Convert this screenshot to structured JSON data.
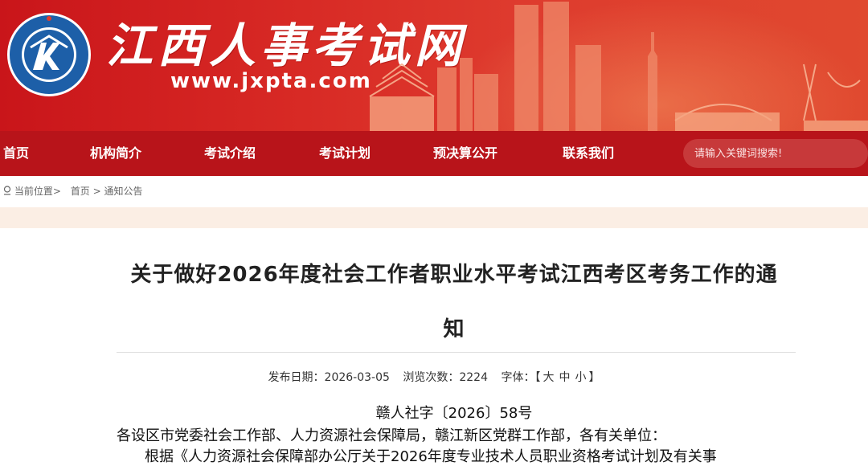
{
  "header": {
    "site_title": "江西人事考试网",
    "site_url": "www.jxpta.com",
    "logo_icon": "jxpta-emblem-icon",
    "colors": {
      "banner_red": "#d82a25",
      "nav_red": "#b8141a",
      "accent_cream": "#fbeee4"
    }
  },
  "nav": {
    "items": [
      {
        "label": "首页"
      },
      {
        "label": "机构简介"
      },
      {
        "label": "考试介绍"
      },
      {
        "label": "考试计划"
      },
      {
        "label": "预决算公开"
      },
      {
        "label": "联系我们"
      }
    ],
    "search_placeholder": "请输入关键词搜索!"
  },
  "breadcrumb": {
    "icon": "location-pin-icon",
    "prefix": "当前位置>",
    "home": "首页",
    "separator": ">",
    "current": "通知公告"
  },
  "article": {
    "title_line1": "关于做好2026年度社会工作者职业水平考试江西考区考务工作的通",
    "title_line2": "知",
    "meta": {
      "date_label": "发布日期：",
      "date_value": "2026-03-05",
      "views_label": "浏览次数：",
      "views_value": "2224",
      "font_label": "字体：",
      "font_open": "【",
      "font_large": "大",
      "font_medium": "中",
      "font_small": "小",
      "font_close": "】"
    },
    "doc_number": "赣人社字〔2026〕58号",
    "addressee": "各设区市党委社会工作部、人力资源社会保障局，赣江新区党群工作部，各有关单位：",
    "body_partial": "根据《人力资源社会保障部办公厅关于2026年度专业技术人员职业资格考试计划及有关事"
  }
}
